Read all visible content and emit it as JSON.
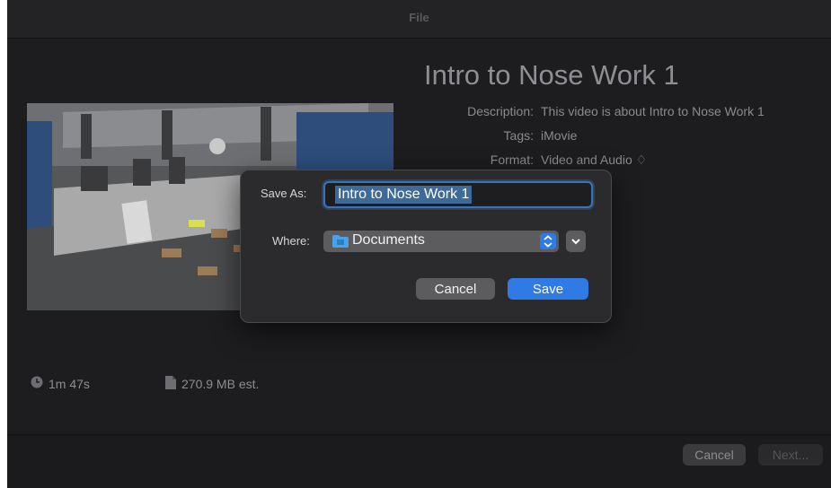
{
  "window": {
    "title": "File"
  },
  "project": {
    "title": "Intro to Nose Work 1",
    "description_label": "Description:",
    "description_value": "This video is about Intro to Nose Work 1",
    "tags_label": "Tags:",
    "tags_value": "iMovie",
    "format_label": "Format:",
    "format_value": "Video and Audio ♢"
  },
  "stats": {
    "duration": "1m 47s",
    "size": "270.9 MB est."
  },
  "footer": {
    "cancel_label": "Cancel",
    "next_label": "Next..."
  },
  "save_dialog": {
    "save_as_label": "Save As:",
    "filename": "Intro to Nose Work 1",
    "where_label": "Where:",
    "where_value": "Documents",
    "cancel_label": "Cancel",
    "save_label": "Save"
  },
  "colors": {
    "accent": "#2f7ae5",
    "background": "#1d1d1f",
    "dialog": "#2b2b2d"
  },
  "icons": [
    "clock-icon",
    "document-icon",
    "folder-icon",
    "updown-chevron-icon",
    "chevron-down-icon"
  ]
}
